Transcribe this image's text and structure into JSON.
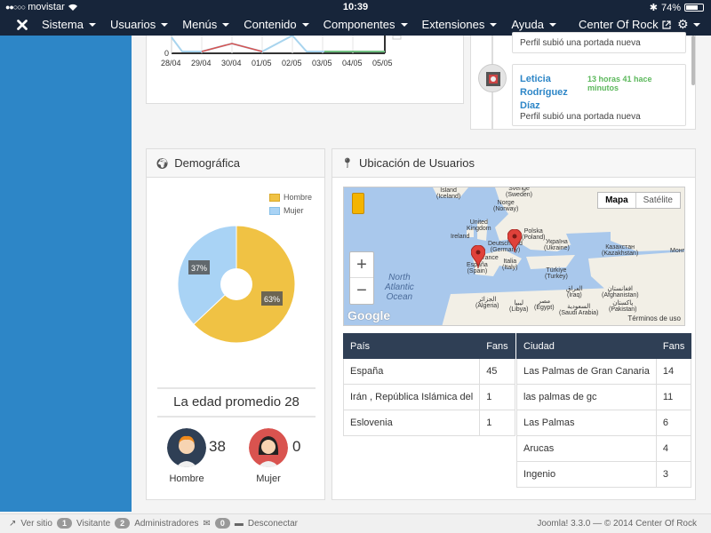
{
  "status_bar": {
    "carrier": "movistar",
    "time": "10:39",
    "battery": "74%",
    "battery_level": 0.74
  },
  "navbar": {
    "menu": [
      {
        "label": "Sistema"
      },
      {
        "label": "Usuarios"
      },
      {
        "label": "Menús"
      },
      {
        "label": "Contenido"
      },
      {
        "label": "Componentes"
      },
      {
        "label": "Extensiones"
      },
      {
        "label": "Ayuda"
      }
    ],
    "site_name": "Center Of Rock"
  },
  "top_chart": {
    "x_ticks": [
      "28/04",
      "29/04",
      "30/04",
      "01/05",
      "02/05",
      "03/05",
      "04/05",
      "05/05"
    ],
    "y_tick": "0"
  },
  "activity": {
    "items": [
      {
        "text": "Perfil subió una portada nueva"
      },
      {
        "name_line1": "Leticia",
        "name_line2": "Rodríguez",
        "name_line3": "Díaz",
        "time": "13 horas 41 hace minutos",
        "text": "Perfil subió una portada nueva"
      }
    ]
  },
  "demografica": {
    "title": "Demográfica",
    "legend": [
      {
        "label": "Hombre",
        "color": "#f0c244"
      },
      {
        "label": "Mujer",
        "color": "#a9d3f5"
      }
    ],
    "slices": [
      {
        "label": "63%",
        "value": 63,
        "color": "#f0c244"
      },
      {
        "label": "37%",
        "value": 37,
        "color": "#a9d3f5"
      }
    ],
    "average_age": "La edad promedio 28",
    "male": {
      "label": "Hombre",
      "count": "38"
    },
    "female": {
      "label": "Mujer",
      "count": "0"
    }
  },
  "ubicacion": {
    "title": "Ubicación de Usuarios",
    "map_type_buttons": [
      "Mapa",
      "Satélite"
    ],
    "zoom_in": "+",
    "zoom_out": "−",
    "map_labels": {
      "iceland": "Ísland\n(Iceland)",
      "sverige": "Sverige\n(Sweden)",
      "norge": "Norge\n(Norway)",
      "uk": "United\nKingdom",
      "ireland": "Ireland",
      "deutschland": "Deutschland\n(Germany)",
      "polska": "Polska\n(Poland)",
      "ukraina": "Україна\n(Ukraine)",
      "kazakhstan": "Казахстан\n(Kazakhstan)",
      "france": "France",
      "italia": "Italia\n(Italy)",
      "espana": "España\n(Spain)",
      "turkiye": "Türkiye\n(Turkey)",
      "iraq": "العراق\n(Iraq)",
      "afghanistan": "افغانستان\n(Afghanistan)",
      "pakistan": "پاکستان\n(Pakistan)",
      "algeria": "الجزائر\n(Algeria)",
      "libya": "ليبيا\n(Libya)",
      "egypt": "مصر\n(Egypt)",
      "saudi": "السعودية\n(Saudi Arabia)",
      "ocean": "North\nAtlantic\nOcean",
      "mongolia": "Монг"
    },
    "google": "Google",
    "terms": "Términos de uso",
    "countries": {
      "headers": [
        "País",
        "Fans"
      ],
      "rows": [
        [
          "España",
          "45"
        ],
        [
          "Irán , República Islámica del",
          "1"
        ],
        [
          "Eslovenia",
          "1"
        ]
      ]
    },
    "cities": {
      "headers": [
        "Ciudad",
        "Fans"
      ],
      "rows": [
        [
          "Las Palmas de Gran Canaria",
          "14"
        ],
        [
          "las palmas de gc",
          "11"
        ],
        [
          "Las Palmas",
          "6"
        ],
        [
          "Arucas",
          "4"
        ],
        [
          "Ingenio",
          "3"
        ]
      ]
    }
  },
  "footer": {
    "view_site": "Ver sitio",
    "visitors_count": "1",
    "visitors_label": "Visitante",
    "admins_count": "2",
    "admins_label": "Administradores",
    "messages_count": "0",
    "logout": "Desconectar",
    "right": "Joomla! 3.3.0  —  © 2014 Center Of Rock"
  }
}
